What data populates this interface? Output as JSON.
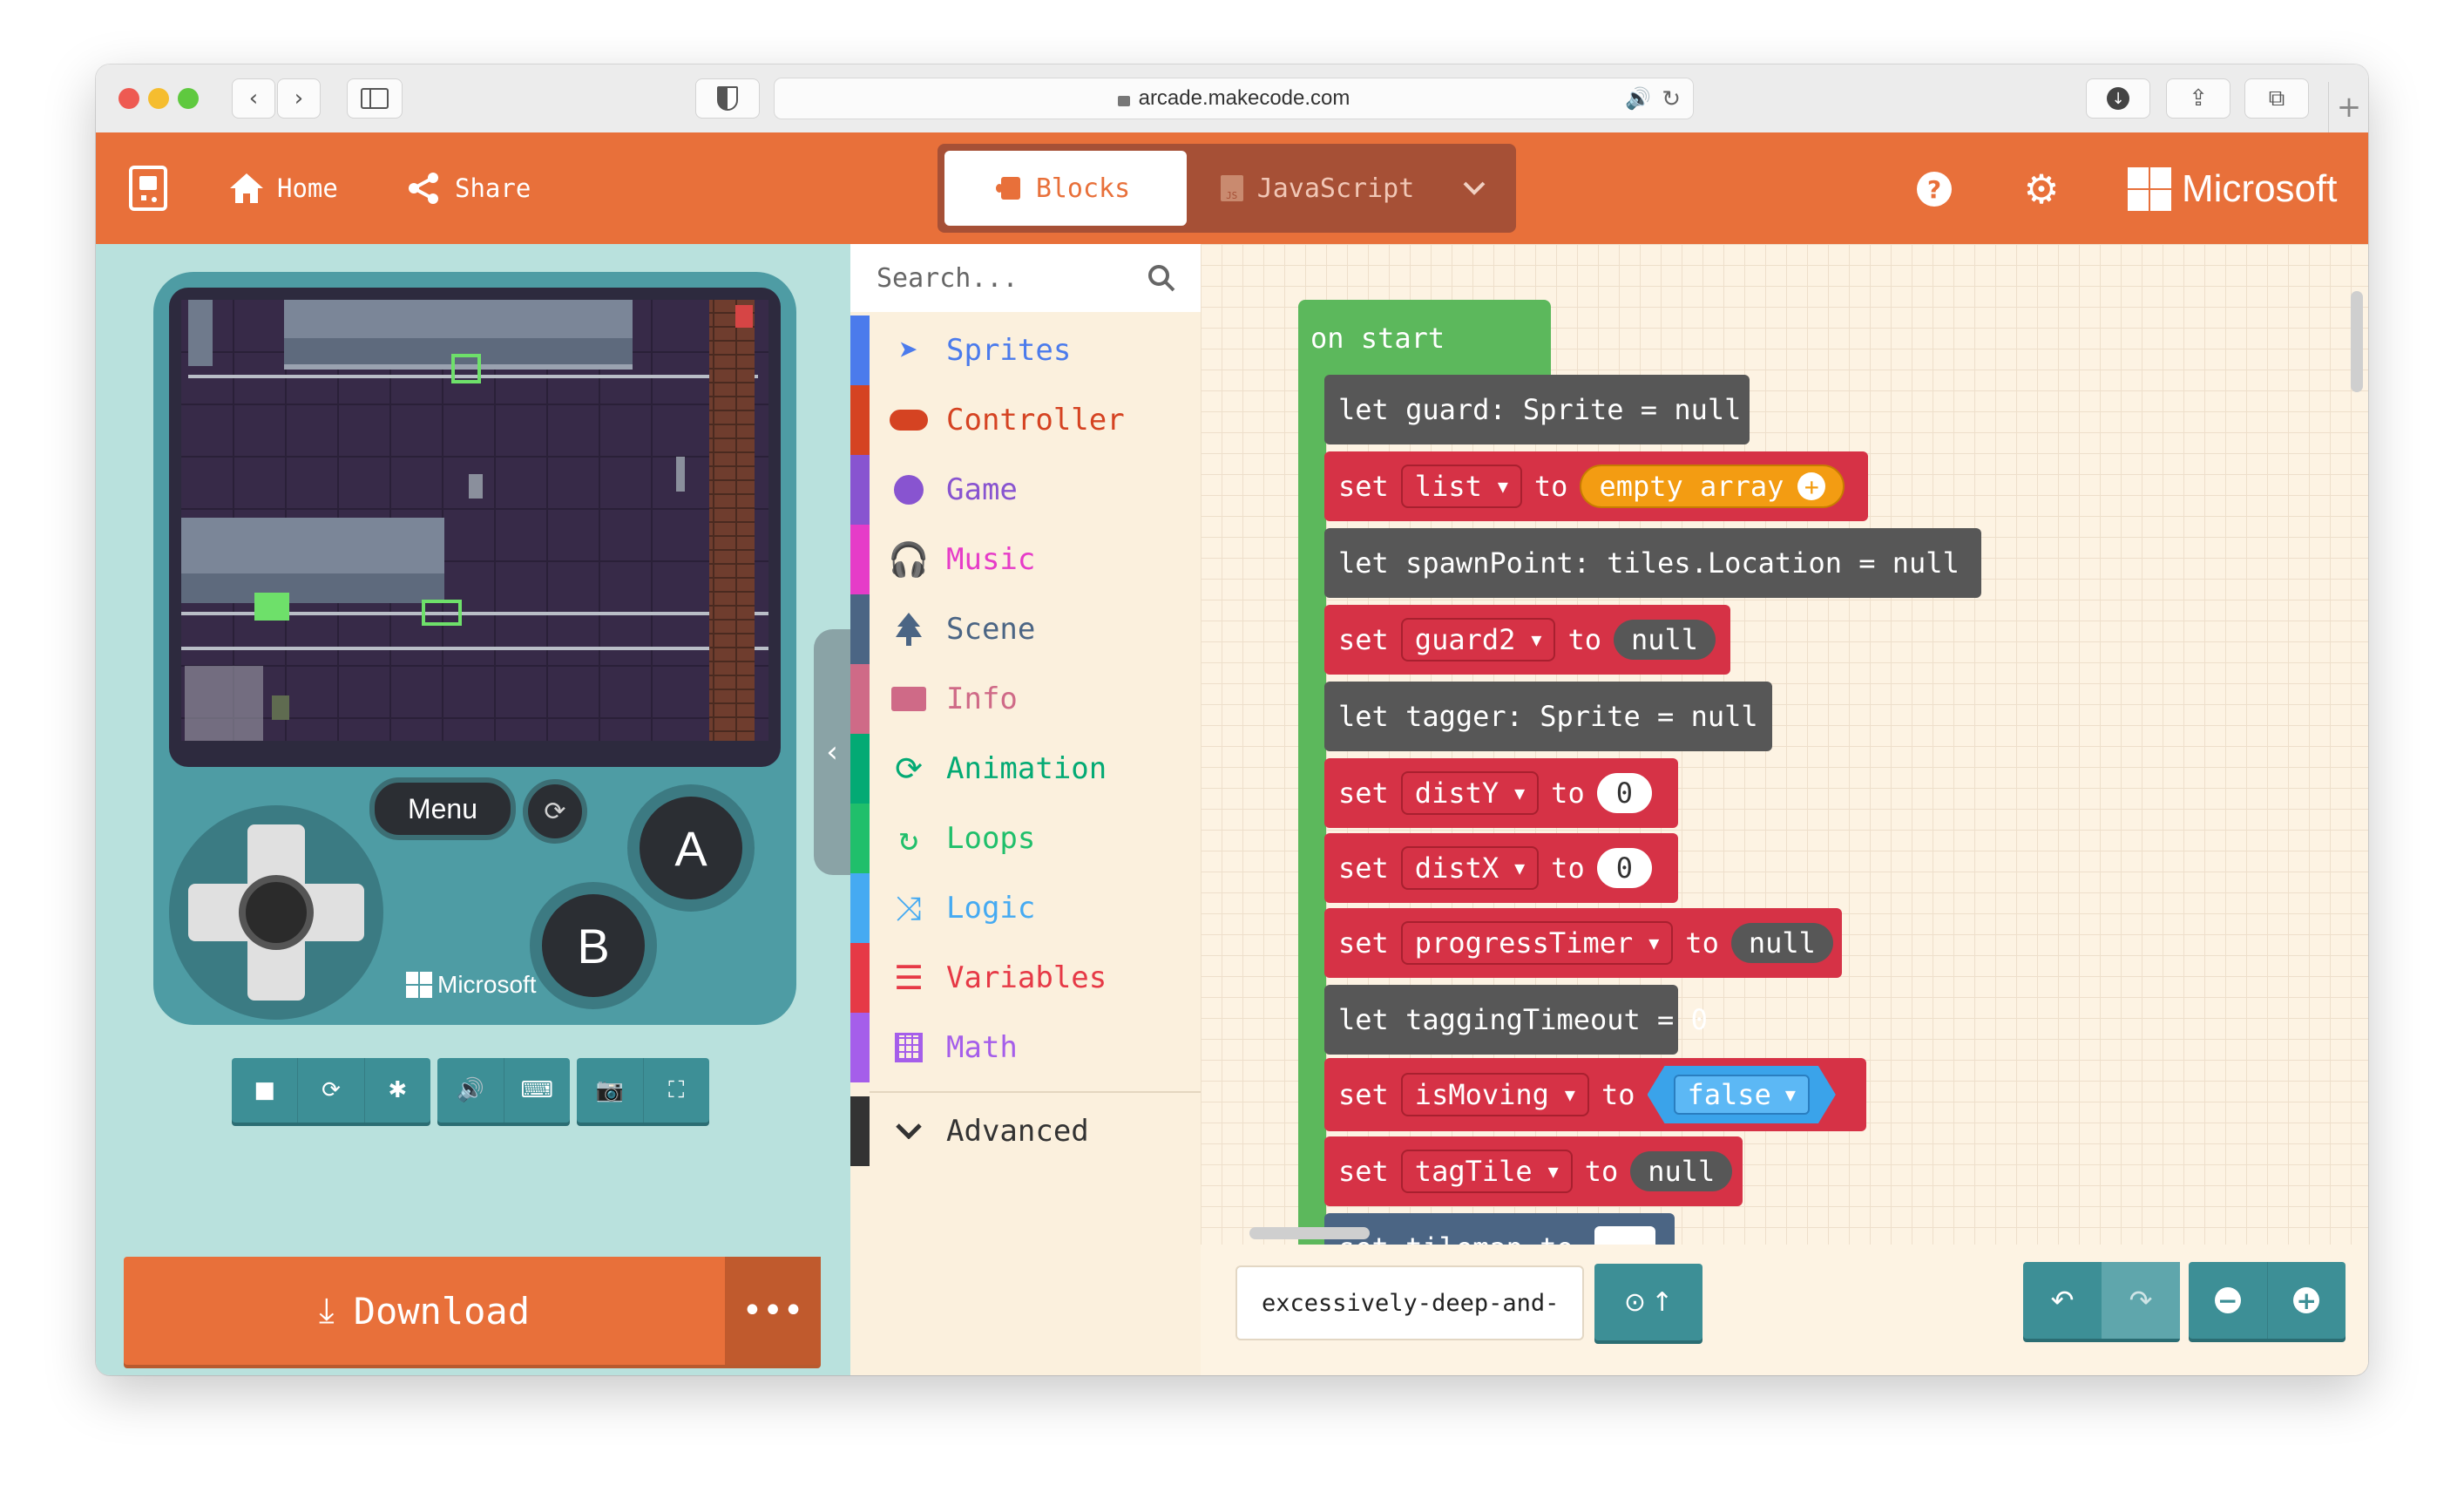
{
  "browser": {
    "url": "arcade.makecode.com"
  },
  "header": {
    "home_label": "Home",
    "share_label": "Share",
    "blocks_tab": "Blocks",
    "javascript_tab": "JavaScript",
    "brand": "Microsoft",
    "color": "#e8703a"
  },
  "simulator": {
    "menu_label": "Menu",
    "a_label": "A",
    "b_label": "B",
    "console_brand": "Microsoft",
    "download_label": "Download"
  },
  "toolbox": {
    "search_placeholder": "Search...",
    "categories": [
      {
        "label": "Sprites",
        "color": "#4b7bec",
        "icon": "paper-plane-icon"
      },
      {
        "label": "Controller",
        "color": "#d54322",
        "icon": "gamepad-icon"
      },
      {
        "label": "Game",
        "color": "#8854d0",
        "icon": "circle-icon"
      },
      {
        "label": "Music",
        "color": "#e63cc8",
        "icon": "headphones-icon"
      },
      {
        "label": "Scene",
        "color": "#4b6584",
        "icon": "tree-icon"
      },
      {
        "label": "Info",
        "color": "#cf6a87",
        "icon": "id-card-icon"
      },
      {
        "label": "Animation",
        "color": "#03aa74",
        "icon": "refresh-icon"
      },
      {
        "label": "Loops",
        "color": "#20bf6b",
        "icon": "redo-icon"
      },
      {
        "label": "Logic",
        "color": "#45aaf2",
        "icon": "shuffle-icon"
      },
      {
        "label": "Variables",
        "color": "#e63946",
        "icon": "list-icon"
      },
      {
        "label": "Math",
        "color": "#a55eea",
        "icon": "calculator-icon"
      }
    ],
    "advanced_label": "Advanced"
  },
  "workspace": {
    "event_label": "on start",
    "blocks": {
      "b1": "let guard: Sprite = null",
      "b2_set": "set",
      "b2_var": "list",
      "b2_to": "to",
      "b2_val": "empty array",
      "b3": "let spawnPoint: tiles.Location = null",
      "b4_var": "guard2",
      "b4_val": "null",
      "b5": "let tagger: Sprite = null",
      "b6_var": "distY",
      "b6_val": "0",
      "b7_var": "distX",
      "b7_val": "0",
      "b8_var": "progressTimer",
      "b8_val": "null",
      "b9": "let taggingTimeout = 0",
      "b10_var": "isMoving",
      "b10_val": "false",
      "b11_var": "tagTile",
      "b11_val": "null",
      "b12": "set tilemap to"
    },
    "project_name": "excessively-deep-and-"
  }
}
